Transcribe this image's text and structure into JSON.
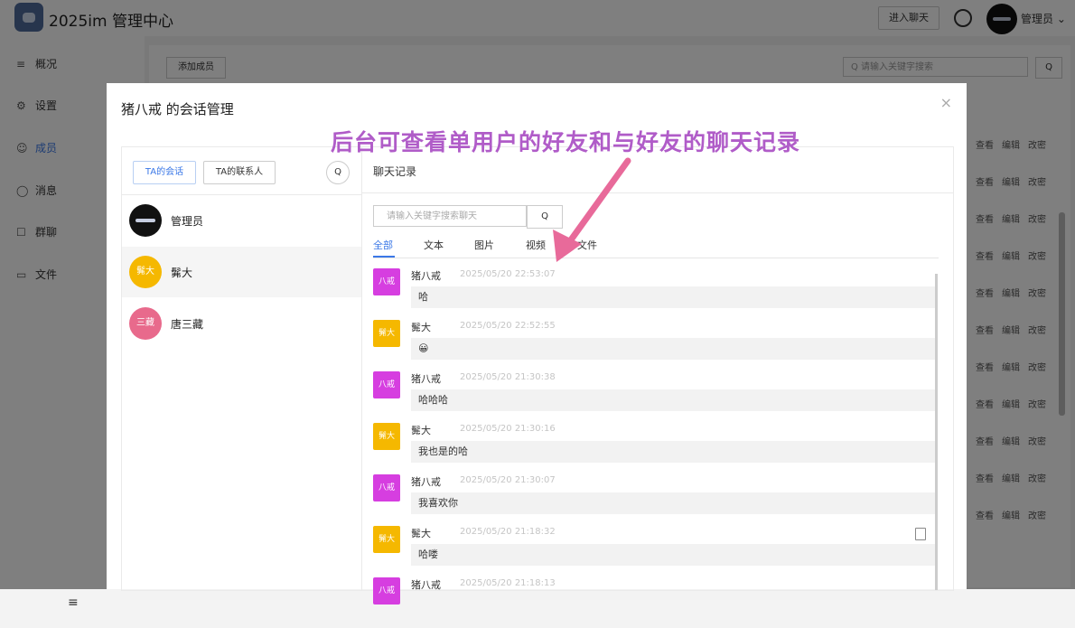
{
  "app": {
    "title": "2025im 管理中心",
    "enter_chat": "进入聊天",
    "user": "管理员 ⌄"
  },
  "sidebar": {
    "items": [
      {
        "label": "概况",
        "icon": "≡"
      },
      {
        "label": "设置",
        "icon": "⚙"
      },
      {
        "label": "成员",
        "icon": "☺"
      },
      {
        "label": "消息",
        "icon": "◯"
      },
      {
        "label": "群聊",
        "icon": "☐"
      },
      {
        "label": "文件",
        "icon": "▭"
      }
    ],
    "toggle": "≡"
  },
  "background": {
    "add_member": "添加成员",
    "search_placeholder": "Q 请输入关键字搜索",
    "search_btn": "Q",
    "row_actions": [
      "查看",
      "编辑",
      "改密"
    ]
  },
  "modal": {
    "title": "猪八戒 的会话管理",
    "close": "×",
    "annotation": "后台可查看单用户的好友和与好友的聊天记录",
    "left": {
      "tabs": [
        "TA的会话",
        "TA的联系人"
      ],
      "search_icon": "Q",
      "contacts": [
        {
          "name": "管理员",
          "avatar_text": "",
          "color": "#111111"
        },
        {
          "name": "髴大",
          "avatar_text": "髴大",
          "color": "#f5b800"
        },
        {
          "name": "唐三藏",
          "avatar_text": "三藏",
          "color": "#e86a8c"
        }
      ]
    },
    "right": {
      "title": "聊天记录",
      "search_placeholder": "请输入关键字搜索聊天",
      "search_btn": "Q",
      "filters": [
        "全部",
        "文本",
        "图片",
        "视频",
        "文件"
      ],
      "messages": [
        {
          "avatar_text": "八戒",
          "color": "#d63ee0",
          "name": "猪八戒",
          "time": "2025/05/20 22:53:07",
          "text": "哈"
        },
        {
          "avatar_text": "髴大",
          "color": "#f5b800",
          "name": "髴大",
          "time": "2025/05/20 22:52:55",
          "text": "😀"
        },
        {
          "avatar_text": "八戒",
          "color": "#d63ee0",
          "name": "猪八戒",
          "time": "2025/05/20 21:30:38",
          "text": "哈哈哈"
        },
        {
          "avatar_text": "髴大",
          "color": "#f5b800",
          "name": "髴大",
          "time": "2025/05/20 21:30:16",
          "text": "我也是的哈"
        },
        {
          "avatar_text": "八戒",
          "color": "#d63ee0",
          "name": "猪八戒",
          "time": "2025/05/20 21:30:07",
          "text": "我喜欢你"
        },
        {
          "avatar_text": "髴大",
          "color": "#f5b800",
          "name": "髴大",
          "time": "2025/05/20 21:18:32",
          "text": "哈喽"
        },
        {
          "avatar_text": "八戒",
          "color": "#d63ee0",
          "name": "猪八戒",
          "time": "2025/05/20 21:18:13",
          "text": ""
        }
      ]
    }
  }
}
